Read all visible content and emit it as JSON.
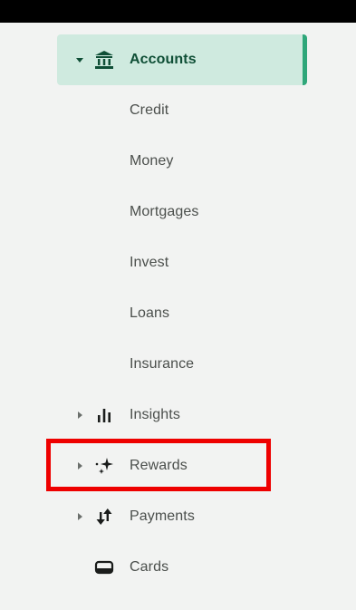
{
  "nav": {
    "accounts": {
      "label": "Accounts",
      "icon": "bank-icon"
    },
    "sub_items": [
      {
        "label": "Credit"
      },
      {
        "label": "Money"
      },
      {
        "label": "Mortgages"
      },
      {
        "label": "Invest"
      },
      {
        "label": "Loans"
      },
      {
        "label": "Insurance"
      }
    ],
    "insights": {
      "label": "Insights",
      "icon": "bar-chart-icon"
    },
    "rewards": {
      "label": "Rewards",
      "icon": "sparkles-icon"
    },
    "payments": {
      "label": "Payments",
      "icon": "transfer-arrows-icon"
    },
    "cards": {
      "label": "Cards",
      "icon": "card-icon"
    }
  },
  "colors": {
    "active_bg": "#cfeadf",
    "active_accent": "#2fa77a",
    "active_text": "#0f4f36",
    "highlight": "#ee0000"
  }
}
